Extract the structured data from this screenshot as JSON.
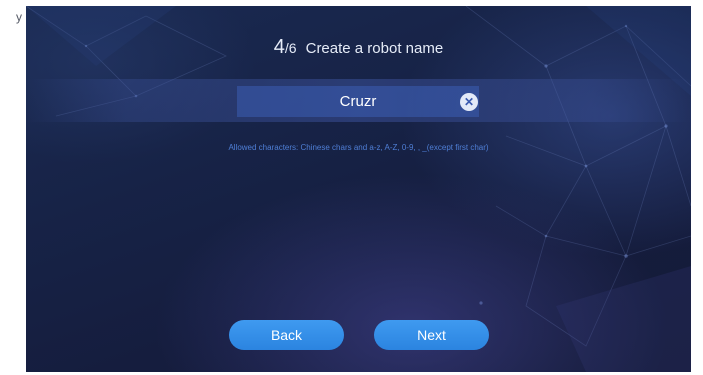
{
  "side_caption": "y",
  "header": {
    "step_current": "4",
    "step_total": "/6",
    "title": "Create a robot name"
  },
  "name_field": {
    "value": "Cruzr",
    "clear_icon": "clear-circle-icon",
    "clear_glyph": "✕"
  },
  "hint": "Allowed characters: Chinese chars and a-z, A-Z, 0-9, ,  _(except first char)",
  "buttons": {
    "back": "Back",
    "next": "Next"
  },
  "colors": {
    "background": "#162044",
    "accent": "#2f8ae6",
    "hint_text": "#4f7fd6",
    "input_fill": "#3a5cb2"
  }
}
